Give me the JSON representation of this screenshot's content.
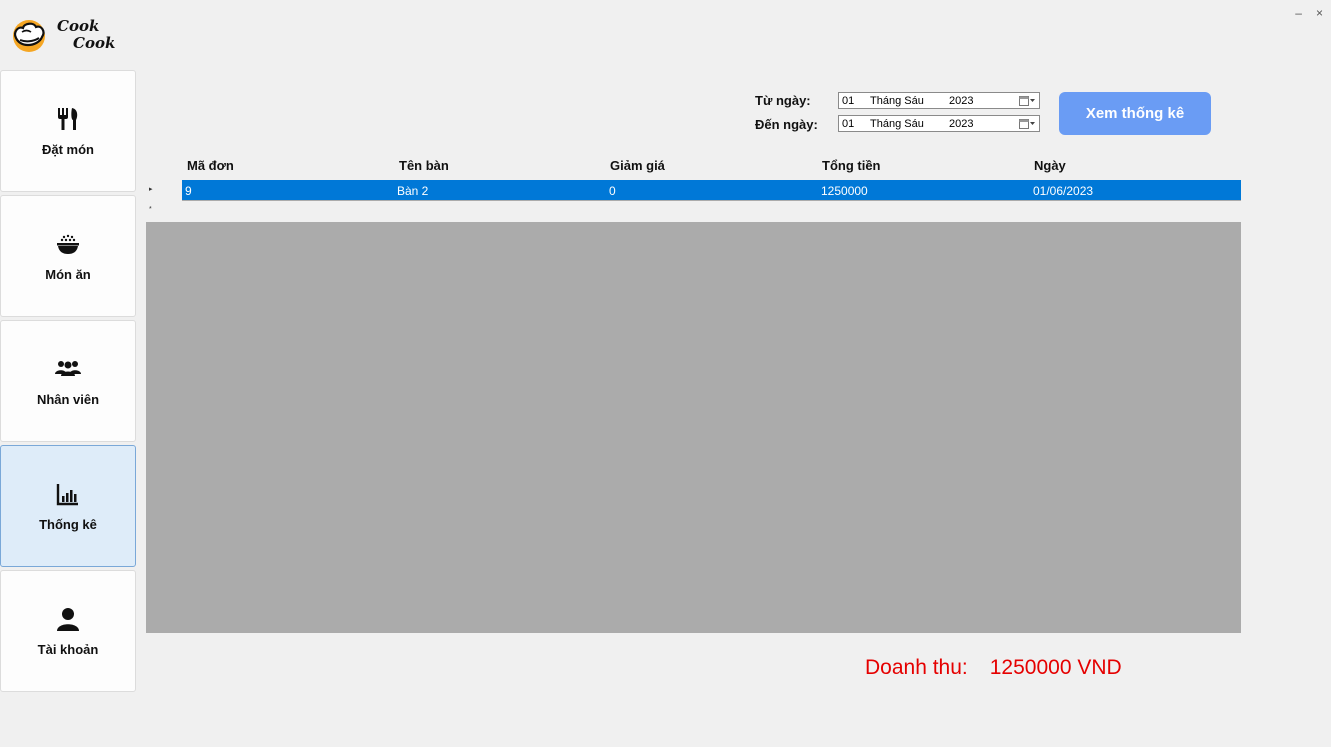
{
  "app": {
    "logo_line1": "Cook",
    "logo_line2": "Cook",
    "window_minimize": "–",
    "window_close": "×"
  },
  "sidebar": {
    "items": [
      {
        "label": "Đặt món",
        "icon": "fork-knife-icon"
      },
      {
        "label": "Món ăn",
        "icon": "rice-bowl-icon"
      },
      {
        "label": "Nhân viên",
        "icon": "users-icon"
      },
      {
        "label": "Thống kê",
        "icon": "bar-chart-icon",
        "active": true
      },
      {
        "label": "Tài khoản",
        "icon": "user-icon"
      }
    ]
  },
  "filter": {
    "from_label": "Từ ngày:",
    "to_label": "Đến ngày:",
    "from_date": {
      "day": "01",
      "month": "Tháng Sáu",
      "year": "2023"
    },
    "to_date": {
      "day": "01",
      "month": "Tháng Sáu",
      "year": "2023"
    },
    "submit_label": "Xem thống kê"
  },
  "table": {
    "columns": [
      "Mã đơn",
      "Tên bàn",
      "Giảm giá",
      "Tổng tiền",
      "Ngày"
    ],
    "rows": [
      [
        "9",
        "Bàn 2",
        "0",
        "1250000",
        "01/06/2023"
      ]
    ],
    "row_indicator": "▸",
    "new_row_indicator": "*"
  },
  "revenue": {
    "label": "Doanh thu:",
    "value": "1250000 VND"
  },
  "colors": {
    "selected_row": "#0078d7",
    "button": "#6a9cf4",
    "revenue_text": "#e50000",
    "grid_background": "#ababab",
    "active_nav": "#deecf9"
  }
}
